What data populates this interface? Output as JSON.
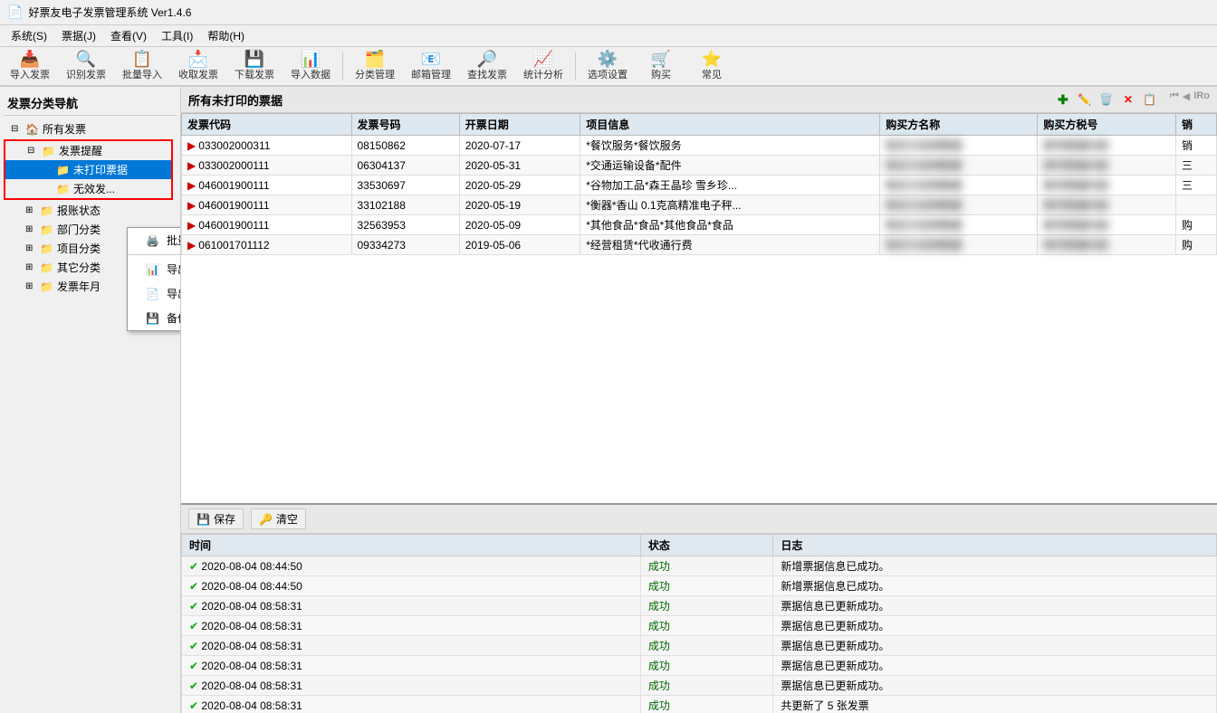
{
  "titleBar": {
    "title": "好票友电子发票管理系统 Ver1.4.6",
    "icon": "📄"
  },
  "menuBar": {
    "items": [
      {
        "id": "system",
        "label": "系统(S)"
      },
      {
        "id": "invoice",
        "label": "票据(J)"
      },
      {
        "id": "view",
        "label": "查看(V)"
      },
      {
        "id": "tools",
        "label": "工具(I)"
      },
      {
        "id": "help",
        "label": "帮助(H)"
      }
    ]
  },
  "toolbar": {
    "buttons": [
      {
        "id": "import-invoice",
        "icon": "📥",
        "label": "导入发票"
      },
      {
        "id": "recognize-invoice",
        "icon": "🔍",
        "label": "识别发票"
      },
      {
        "id": "batch-import",
        "icon": "📋",
        "label": "批量导入"
      },
      {
        "id": "receive-invoice",
        "icon": "📩",
        "label": "收取发票"
      },
      {
        "id": "download-invoice",
        "icon": "💾",
        "label": "下载发票"
      },
      {
        "id": "import-data",
        "icon": "📊",
        "label": "导入数据"
      },
      {
        "id": "category-manage",
        "icon": "🗂️",
        "label": "分类管理"
      },
      {
        "id": "mailbox-manage",
        "icon": "📧",
        "label": "邮箱管理"
      },
      {
        "id": "find-invoice",
        "icon": "🔎",
        "label": "查找发票"
      },
      {
        "id": "stat-analysis",
        "icon": "📈",
        "label": "统计分析"
      },
      {
        "id": "options-settings",
        "icon": "⚙️",
        "label": "选项设置"
      },
      {
        "id": "buy",
        "icon": "🛒",
        "label": "购买"
      },
      {
        "id": "common",
        "icon": "⭐",
        "label": "常见"
      }
    ]
  },
  "sidebar": {
    "title": "发票分类导航",
    "tree": [
      {
        "id": "all-invoices",
        "label": "所有发票",
        "icon": "🏠",
        "expanded": true,
        "level": 0,
        "children": [
          {
            "id": "invoice-reminder",
            "label": "发票提醒",
            "icon": "📁",
            "expanded": true,
            "level": 1,
            "children": [
              {
                "id": "unprinted",
                "label": "未打印票据",
                "icon": "📁",
                "level": 2,
                "selected": true,
                "highlighted": true
              },
              {
                "id": "invalid",
                "label": "无效发...",
                "icon": "📁",
                "level": 2
              }
            ]
          },
          {
            "id": "accounting-status",
            "label": "报账状态",
            "icon": "📁",
            "level": 1,
            "expanded": false
          },
          {
            "id": "dept-category",
            "label": "部门分类",
            "icon": "📁",
            "level": 1,
            "expanded": false
          },
          {
            "id": "project-category",
            "label": "项目分类",
            "icon": "📁",
            "level": 1,
            "expanded": false
          },
          {
            "id": "other-category",
            "label": "其它分类",
            "icon": "📁",
            "level": 1,
            "expanded": false
          },
          {
            "id": "invoice-year",
            "label": "发票年月",
            "icon": "📁",
            "level": 1,
            "expanded": false
          }
        ]
      }
    ]
  },
  "contextMenu": {
    "items": [
      {
        "id": "batch-print",
        "icon": "🖨️",
        "label": "批量打印票据"
      },
      {
        "id": "export-records",
        "icon": "📊",
        "label": "导出票据记录"
      },
      {
        "id": "export-files",
        "icon": "📄",
        "label": "导出票据文件"
      },
      {
        "id": "backup-data",
        "icon": "💾",
        "label": "备份票据数据"
      }
    ]
  },
  "invoicePanel": {
    "title": "所有未打印的票据",
    "toolbarIcons": [
      "+",
      "✏️",
      "🗑️",
      "❌",
      "📋",
      "◀◀",
      "◀",
      "▶"
    ],
    "columns": [
      "发票代码",
      "发票号码",
      "开票日期",
      "项目信息",
      "购买方名称",
      "购买方税号",
      "销"
    ],
    "rows": [
      {
        "code": "033002000311",
        "number": "08150862",
        "date": "2020-07-17",
        "items": "*餐饮服务*餐饮服务",
        "buyerName": "[模糊]",
        "buyerTax": "[模糊]",
        "extra": "销"
      },
      {
        "code": "033002000111",
        "number": "06304137",
        "date": "2020-05-31",
        "items": "*交通运输设备*配件",
        "buyerName": "[模糊]",
        "buyerTax": "[模糊]",
        "extra": "三"
      },
      {
        "code": "046001900111",
        "number": "33530697",
        "date": "2020-05-29",
        "items": "*谷物加工品*森王晶珍 雪乡珍...",
        "buyerName": "|",
        "buyerTax": "[模糊]",
        "extra": "三"
      },
      {
        "code": "046001900111",
        "number": "33102188",
        "date": "2020-05-19",
        "items": "*衡器*香山 0.1克高精准电子秤...",
        "buyerName": "[模糊]",
        "buyerTax": "[模糊]",
        "extra": ""
      },
      {
        "code": "046001900111",
        "number": "32563953",
        "date": "2020-05-09",
        "items": "*其他食品*食品*其他食品*食品",
        "buyerName": "[模糊]",
        "buyerTax": "[模糊]",
        "extra": "购"
      },
      {
        "code": "061001701112",
        "number": "09334273",
        "date": "2019-05-06",
        "items": "*经营租赁*代收通行费",
        "buyerName": "[模糊]",
        "buyerTax": "[模糊]",
        "extra": "购"
      }
    ]
  },
  "logPanel": {
    "saveLabel": "保存",
    "clearLabel": "清空",
    "columns": [
      "时间",
      "状态",
      "日志"
    ],
    "rows": [
      {
        "time": "2020-08-04 08:44:50",
        "status": "成功",
        "log": "新增票据信息已成功。"
      },
      {
        "time": "2020-08-04 08:44:50",
        "status": "成功",
        "log": "新增票据信息已成功。"
      },
      {
        "time": "2020-08-04 08:58:31",
        "status": "成功",
        "log": "票据信息已更新成功。"
      },
      {
        "time": "2020-08-04 08:58:31",
        "status": "成功",
        "log": "票据信息已更新成功。"
      },
      {
        "time": "2020-08-04 08:58:31",
        "status": "成功",
        "log": "票据信息已更新成功。"
      },
      {
        "time": "2020-08-04 08:58:31",
        "status": "成功",
        "log": "票据信息已更新成功。"
      },
      {
        "time": "2020-08-04 08:58:31",
        "status": "成功",
        "log": "票据信息已更新成功。"
      },
      {
        "time": "2020-08-04 08:58:31",
        "status": "成功",
        "log": "共更新了 5 张发票"
      }
    ]
  }
}
